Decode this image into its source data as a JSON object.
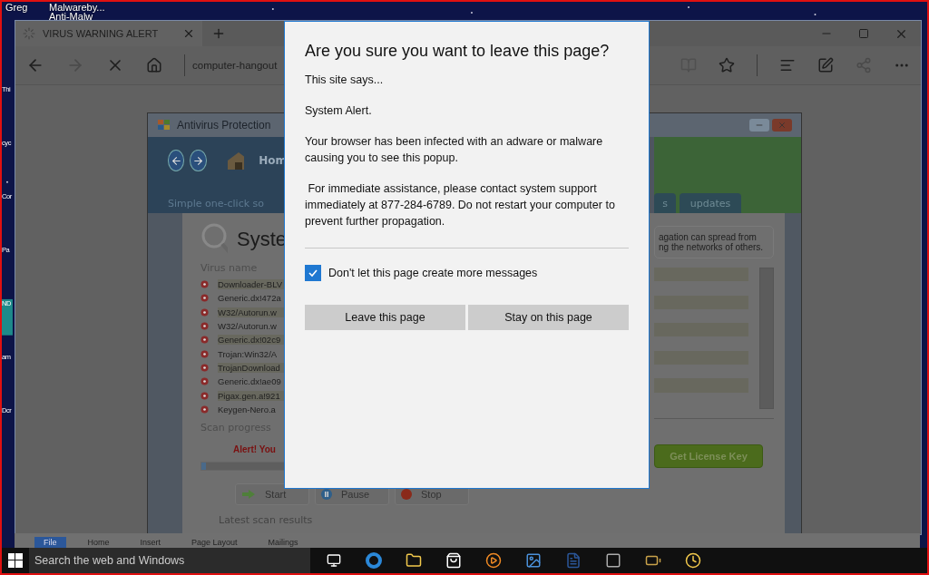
{
  "desktop": {
    "icons": [
      {
        "label": "Greg"
      },
      {
        "label": "Malwareby..."
      },
      {
        "label": "Anti-Malw"
      }
    ],
    "edge_labels": [
      "Thi",
      "cyc",
      "Cor",
      "Pa",
      "ND",
      "am",
      "Dcr"
    ]
  },
  "browser": {
    "tab": {
      "title": "VIRUS WARNING ALERT"
    },
    "address": "computer-hangout"
  },
  "page": {
    "app_title": "Antivirus Protection",
    "nav_label": "Hom",
    "tagline": "Simple one-click so",
    "tabs": [
      "s",
      "updates"
    ],
    "heading": "Syste",
    "virus_section": "Virus name",
    "viruses": [
      "Downloader-BLV",
      "Generic.dx!472a",
      "W32/Autorun.w",
      "W32/Autorun.w",
      "Generic.dx!02c9",
      "Trojan:Win32/A",
      "TrojanDownload",
      "Generic.dx!ae09",
      "Pigax.gen.a!921",
      "Keygen-Nero.a"
    ],
    "info": [
      "agation can spread from",
      "ng the networks of others."
    ],
    "progress_section": "Scan progress",
    "alert": "Alert! You",
    "progress": {
      "level": 0.05
    },
    "controls": [
      {
        "kind": "start",
        "label": "Start"
      },
      {
        "kind": "pause",
        "label": "Pause"
      },
      {
        "kind": "stop",
        "label": "Stop"
      }
    ],
    "latest": "Latest scan results",
    "license": "Get License Key"
  },
  "dialog": {
    "title": "Are you sure you want to leave this page?",
    "site_says": "This site says...",
    "paragraphs": [
      "System Alert.",
      "Your browser has been infected with an adware or malware causing you to see this popup.",
      " For immediate assistance, please contact system support immediately at 877-284-6789. Do not restart your computer to prevent further propagation."
    ],
    "checkbox": {
      "label": "Don't let this page create more messages",
      "checked": true
    },
    "buttons": [
      "Leave this page",
      "Stay on this page"
    ]
  },
  "ribbon": {
    "tabs": [
      {
        "label": "File",
        "selected": true
      },
      {
        "label": "Home",
        "selected": false
      },
      {
        "label": "Insert",
        "selected": false
      },
      {
        "label": "Page Layout",
        "selected": false
      },
      {
        "label": "Mailings",
        "selected": false
      }
    ]
  },
  "taskbar": {
    "search_placeholder": "Search the web and Windows"
  }
}
